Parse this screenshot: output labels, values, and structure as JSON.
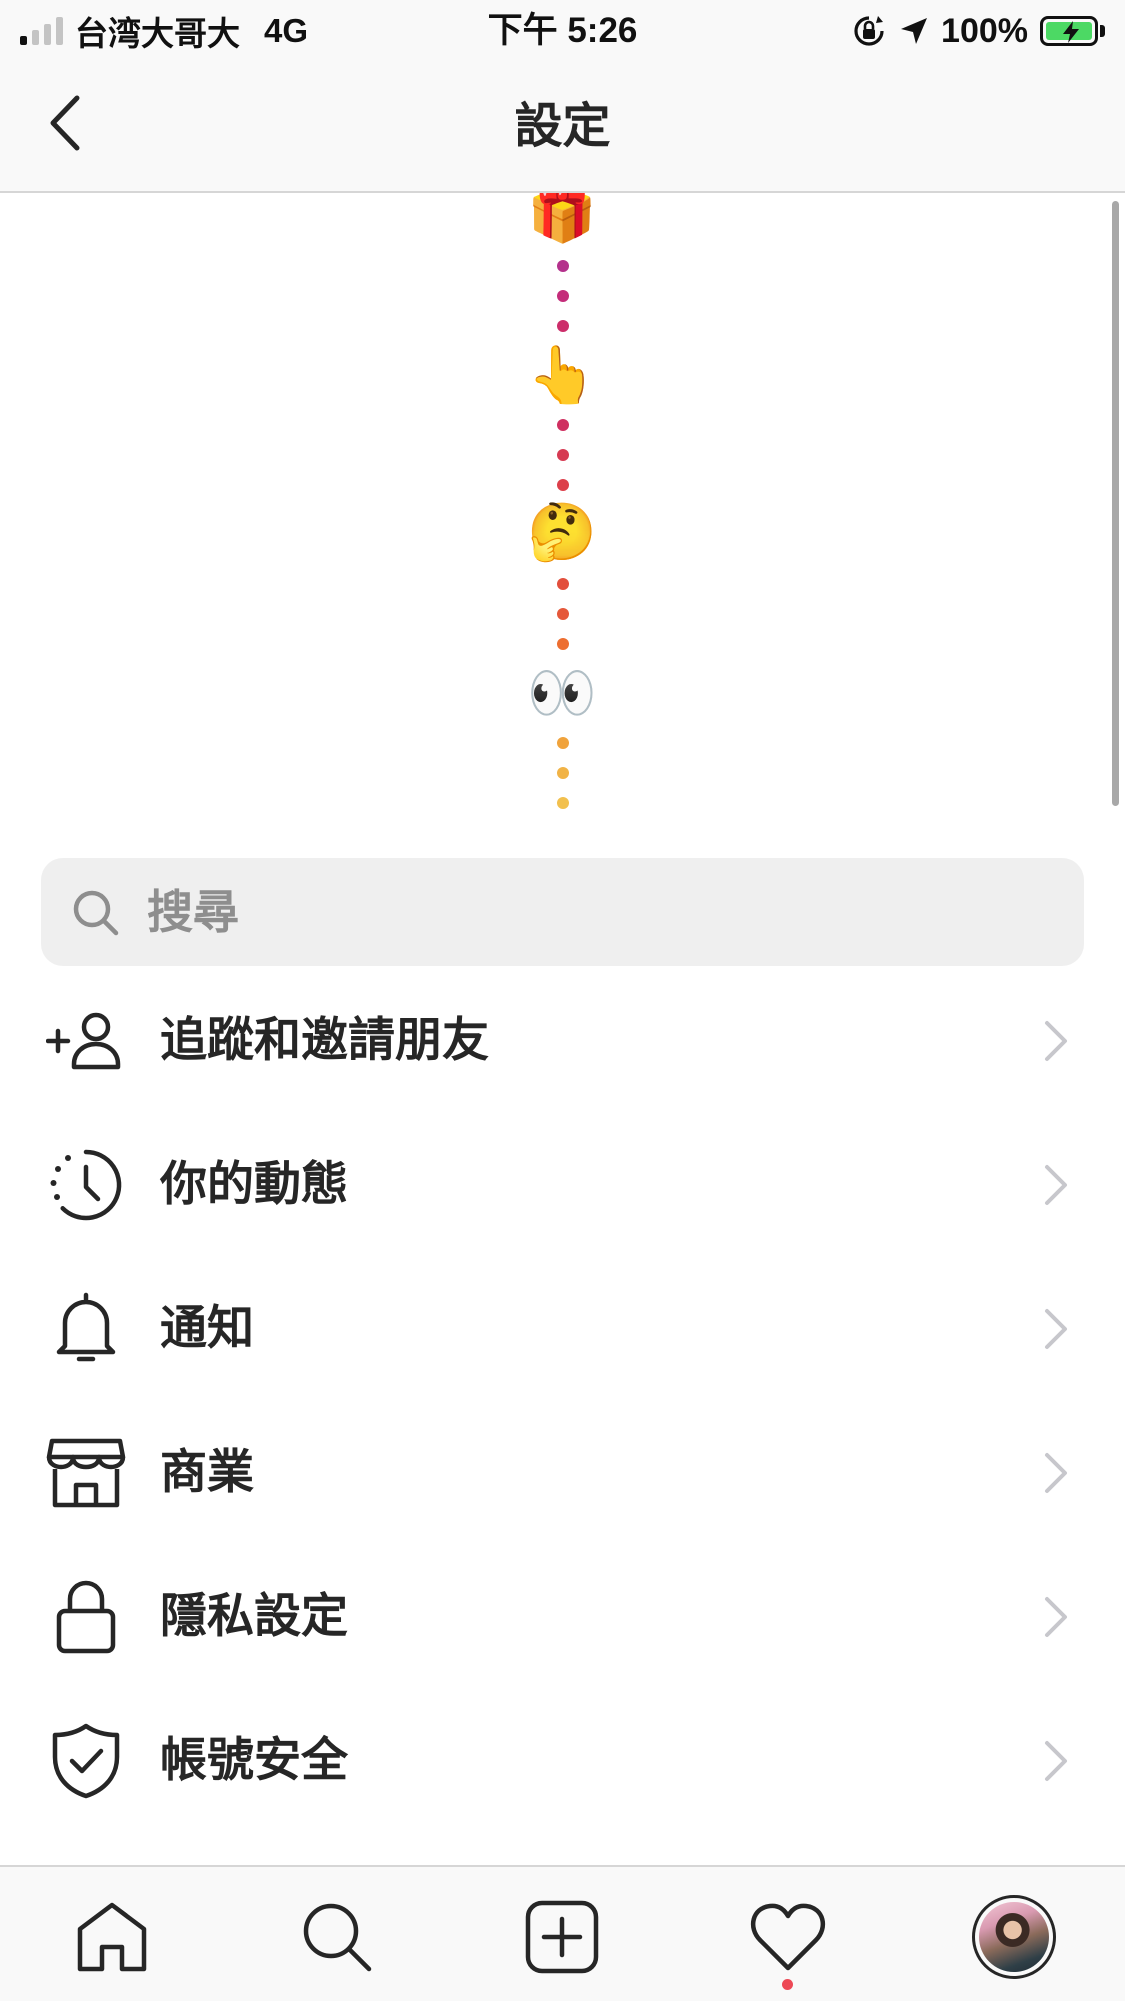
{
  "status_bar": {
    "carrier": "台湾大哥大",
    "network": "4G",
    "time": "下午 5:26",
    "battery": "100%",
    "battery_color": "#4cd964"
  },
  "nav": {
    "title": "設定",
    "back_icon": "chevron-left-icon"
  },
  "promo": {
    "emojis": [
      "🎁",
      "👆",
      "🤔",
      "👀"
    ],
    "dot_colors": [
      "#b4318c",
      "#c42c7a",
      "#cc2d6a",
      "#cf2f60",
      "#d63a52",
      "#dc3f4a",
      "#e24f3c",
      "#e5583a",
      "#ed6e30",
      "#f0a33c",
      "#f1b346",
      "#f2c04e"
    ]
  },
  "search": {
    "placeholder": "搜尋"
  },
  "menu": {
    "items": [
      {
        "label": "追蹤和邀請朋友",
        "icon": "add-person-icon"
      },
      {
        "label": "你的動態",
        "icon": "activity-clock-icon"
      },
      {
        "label": "通知",
        "icon": "bell-icon"
      },
      {
        "label": "商業",
        "icon": "shop-icon"
      },
      {
        "label": "隱私設定",
        "icon": "lock-icon"
      },
      {
        "label": "帳號安全",
        "icon": "shield-check-icon"
      }
    ]
  },
  "tab_bar": {
    "tabs": [
      "home-icon",
      "search-icon",
      "new-post-icon",
      "heart-icon",
      "profile-avatar"
    ],
    "activity_dot_color": "#ed4956"
  }
}
